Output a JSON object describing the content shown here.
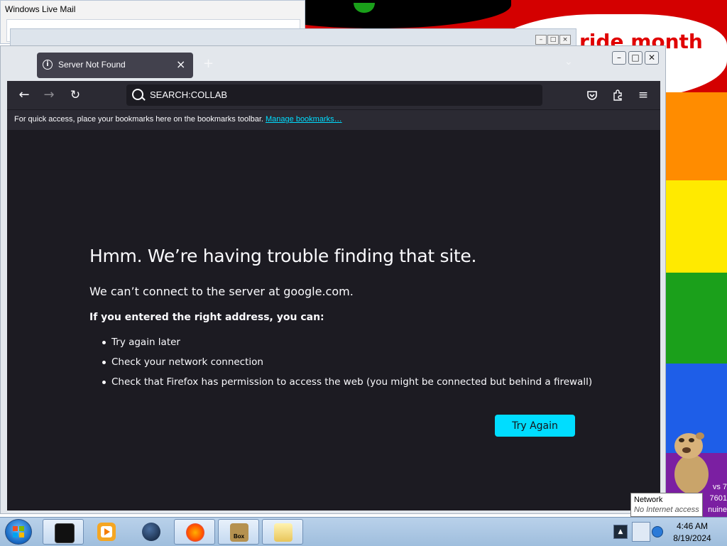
{
  "desktop": {
    "wallpaper_text": "ride month",
    "wallpaper_stripe_colors": [
      "#ff8c00",
      "#ffea00",
      "#1ba01b",
      "#1e5ee8",
      "#7b1fa2"
    ],
    "windows_version_lines": [
      "vs 7",
      "7601",
      "nuine"
    ]
  },
  "background_windows": {
    "wlm_title": "Windows Live Mail"
  },
  "browser": {
    "tab": {
      "title": "Server Not Found",
      "close_icon": "close-icon",
      "info_icon": "info-icon"
    },
    "new_tab_icon": "plus-icon",
    "window_controls": [
      "minimize-icon",
      "maximize-icon",
      "close-icon"
    ],
    "toolbar": {
      "back_icon": "back-arrow-icon",
      "forward_icon": "forward-arrow-icon",
      "reload_icon": "reload-icon",
      "url": "SEARCH:COLLAB",
      "pocket_icon": "pocket-icon",
      "extensions_icon": "extensions-icon",
      "menu_icon": "hamburger-menu-icon"
    },
    "bookmarks_bar": {
      "hint": "For quick access, place your bookmarks here on the bookmarks toolbar.",
      "manage_link": "Manage bookmarks…"
    },
    "error_page": {
      "title": "Hmm. We’re having trouble finding that site.",
      "description": "We can’t connect to the server at google.com.",
      "hint": "If you entered the right address, you can:",
      "suggestions": [
        "Try again later",
        "Check your network connection",
        "Check that Firefox has permission to access the web (you might be connected but behind a firewall)"
      ],
      "try_again_label": "Try Again"
    }
  },
  "taskbar": {
    "programs": [
      "terminal-icon",
      "media-player-icon",
      "globe-icon",
      "firefox-icon",
      "box-game-icon",
      "explorer-icon"
    ],
    "box_label": "Box",
    "clock_time": "4:46 AM",
    "clock_date": "8/19/2024"
  },
  "tooltip": {
    "title": "Network",
    "body": "No Internet access"
  },
  "colors": {
    "firefox_bg": "#1c1b22",
    "toolbar_bg": "#2b2a33",
    "accent": "#00ddff"
  }
}
